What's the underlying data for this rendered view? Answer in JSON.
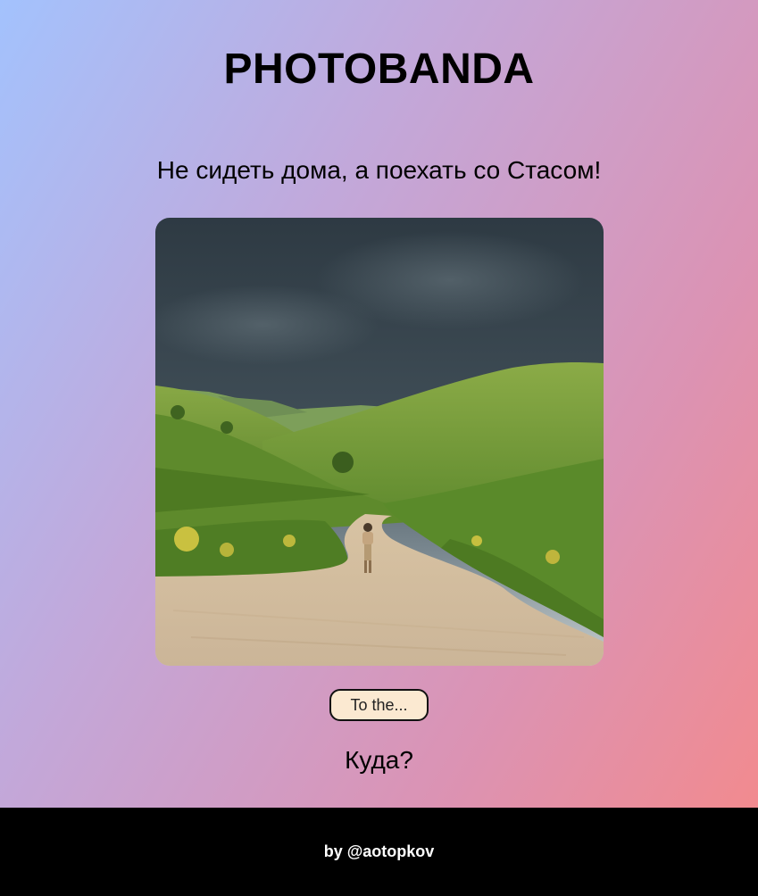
{
  "header": {
    "title": "PHOTOBANDA"
  },
  "main": {
    "tagline": "Не сидеть дома, а поехать со Стасом!",
    "photo": {
      "icon": "landscape-photo"
    },
    "button_label": "To the...",
    "question": "Куда?"
  },
  "footer": {
    "credit": "by @aotopkov"
  },
  "colors": {
    "gradient_start": "#a3c2fd",
    "gradient_end": "#f58989",
    "footer_bg": "#000000",
    "button_bg": "#fbe9d1"
  }
}
